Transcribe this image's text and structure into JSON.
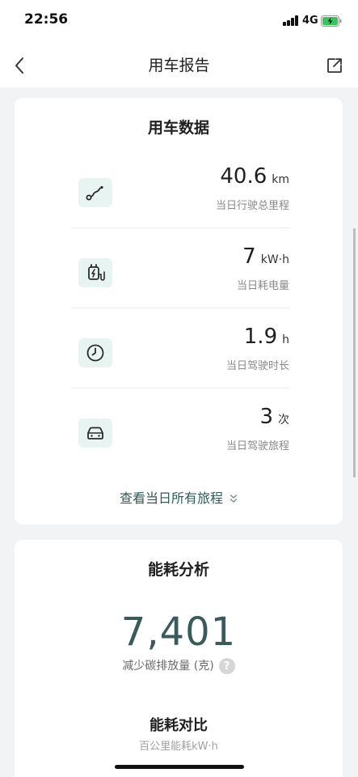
{
  "status_bar": {
    "time": "22:56",
    "network": "4G"
  },
  "nav": {
    "title": "用车报告",
    "back_icon": "chevron-left-icon",
    "share_icon": "share-icon"
  },
  "usage_card": {
    "title": "用车数据",
    "stats": [
      {
        "icon": "route-icon",
        "value": "40.6",
        "unit": "km",
        "label": "当日行驶总里程"
      },
      {
        "icon": "charging-icon",
        "value": "7",
        "unit": "kW·h",
        "label": "当日耗电量"
      },
      {
        "icon": "clock-icon",
        "value": "1.9",
        "unit": "h",
        "label": "当日驾驶时长"
      },
      {
        "icon": "car-icon",
        "value": "3",
        "unit": "次",
        "label": "当日驾驶旅程"
      }
    ],
    "view_all": "查看当日所有旅程"
  },
  "energy_card": {
    "title": "能耗分析",
    "carbon_value": "7,401",
    "carbon_label": "减少碳排放量 (克)",
    "compare_title": "能耗对比",
    "compare_caption": "百公里能耗kW·h"
  },
  "colors": {
    "accent": "#2f5a55",
    "icon_bg": "#e8f4f1",
    "number": "#3b5a5a"
  }
}
